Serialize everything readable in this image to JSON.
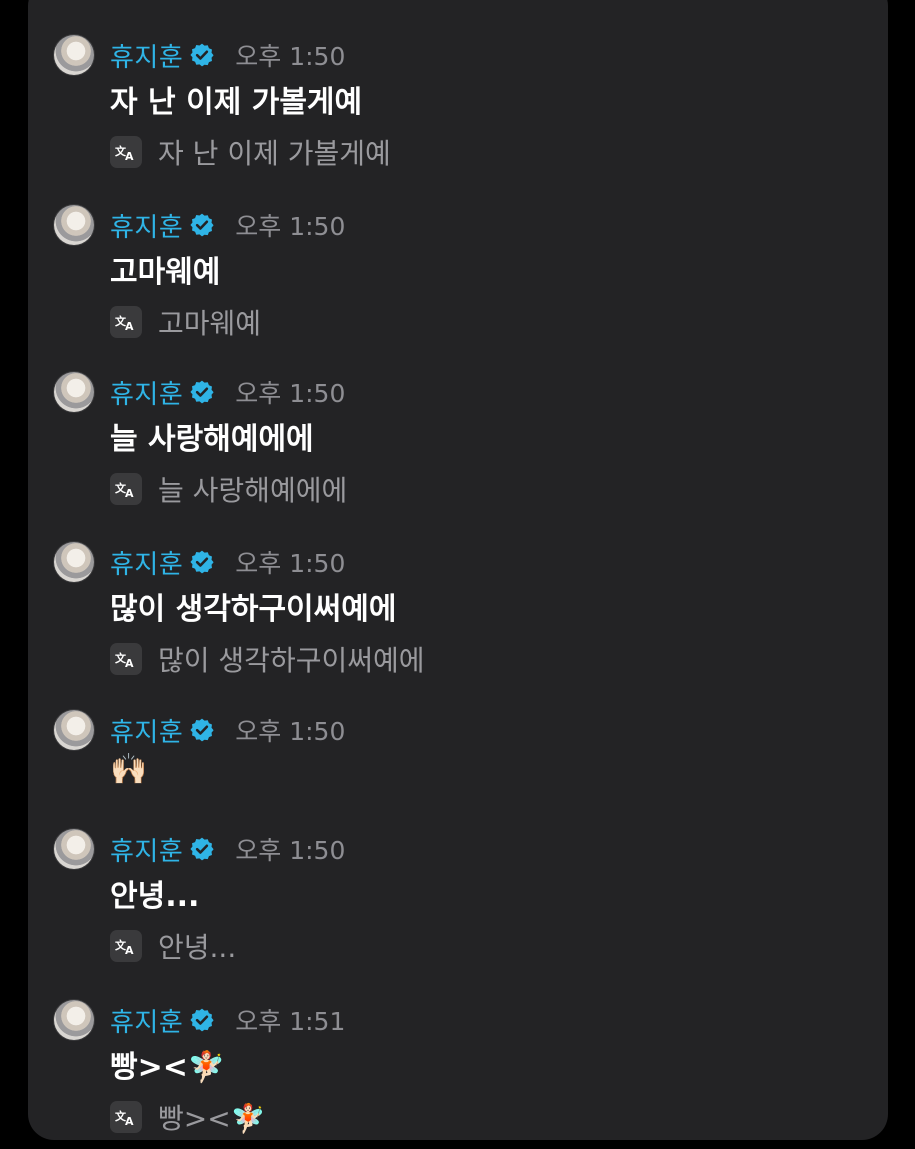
{
  "messages": [
    {
      "name": "휴지훈",
      "time": "오후 1:50",
      "text": "자 난 이제 가볼게예",
      "translation": "자 난 이제 가볼게예"
    },
    {
      "name": "휴지훈",
      "time": "오후 1:50",
      "text": "고마웨예",
      "translation": "고마웨예"
    },
    {
      "name": "휴지훈",
      "time": "오후 1:50",
      "text": "늘 사랑해예에에",
      "translation": "늘 사랑해예에에"
    },
    {
      "name": "휴지훈",
      "time": "오후 1:50",
      "text": "많이 생각하구이써예에",
      "translation": "많이 생각하구이써예에"
    },
    {
      "name": "휴지훈",
      "time": "오후 1:50",
      "text": "🙌🏻"
    },
    {
      "name": "휴지훈",
      "time": "오후 1:50",
      "text": "안녕...",
      "translation": "안녕..."
    },
    {
      "name": "휴지훈",
      "time": "오후 1:51",
      "text": "빵><",
      "text_emoji": "🧚🏻",
      "translation": "빵><",
      "translation_emoji": "🧚🏻"
    }
  ],
  "icons": {
    "avatar": "avatar",
    "verified": "verified-badge-icon",
    "translate": "translate-icon"
  },
  "colors": {
    "name": "#2fb4e6",
    "verified": "#2fb4e6",
    "background": "#232325"
  }
}
